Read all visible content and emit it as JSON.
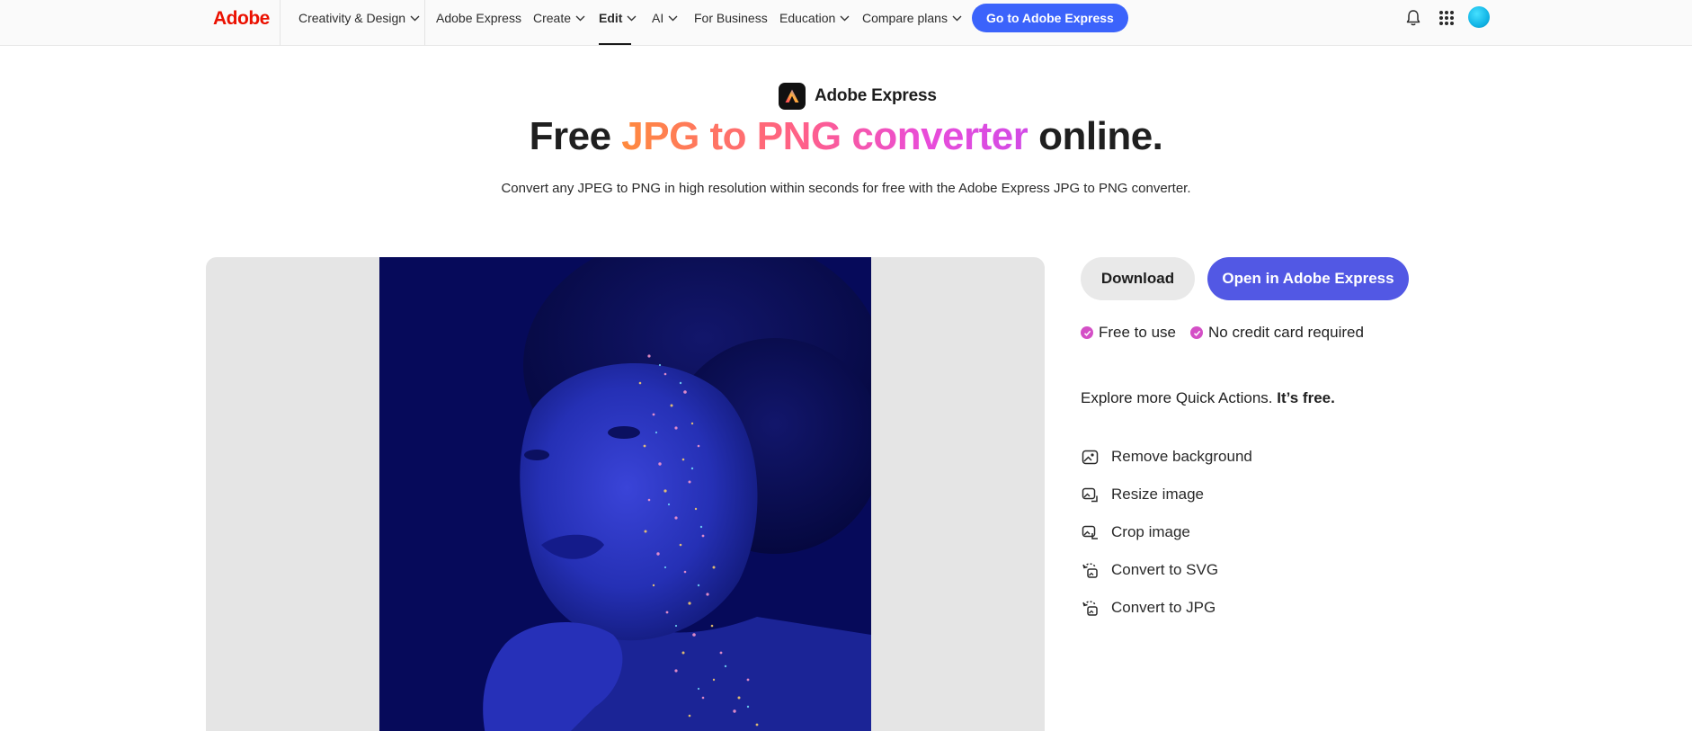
{
  "nav": {
    "logo": "Adobe",
    "items": [
      {
        "label": "Creativity & Design",
        "dropdown": true
      },
      {
        "label": "Adobe Express",
        "dropdown": false
      },
      {
        "label": "Create",
        "dropdown": true
      },
      {
        "label": "Edit",
        "dropdown": true,
        "active": true
      },
      {
        "label": "AI",
        "dropdown": true
      },
      {
        "label": "For Business",
        "dropdown": false
      },
      {
        "label": "Education",
        "dropdown": true
      },
      {
        "label": "Compare plans",
        "dropdown": true
      }
    ],
    "cta": "Go to Adobe Express",
    "icons": [
      "bell-icon",
      "app-grid-icon",
      "avatar"
    ]
  },
  "hero": {
    "brand": "Adobe Express",
    "headline": {
      "prefix": "Free ",
      "highlight": "JPG to PNG converter",
      "suffix": " online."
    },
    "subtitle": "Convert any JPEG to PNG in high resolution within seconds for free with the Adobe Express JPG to PNG converter."
  },
  "actions": {
    "download": "Download",
    "open": "Open in Adobe Express"
  },
  "checks": [
    "Free to use",
    "No credit card required"
  ],
  "explore": {
    "text": "Explore more Quick Actions. ",
    "bold": "It’s free."
  },
  "quick_actions": [
    {
      "label": "Remove background",
      "icon": "remove-background-icon"
    },
    {
      "label": "Resize image",
      "icon": "resize-image-icon"
    },
    {
      "label": "Crop image",
      "icon": "crop-image-icon"
    },
    {
      "label": "Convert to SVG",
      "icon": "convert-icon"
    },
    {
      "label": "Convert to JPG",
      "icon": "convert-icon"
    }
  ],
  "colors": {
    "adobe_red": "#eb1000",
    "cta_blue": "#3b63fb",
    "open_button": "#5258e4",
    "check_pink": "#d44fc6",
    "photo_bg": "#060a5a"
  }
}
